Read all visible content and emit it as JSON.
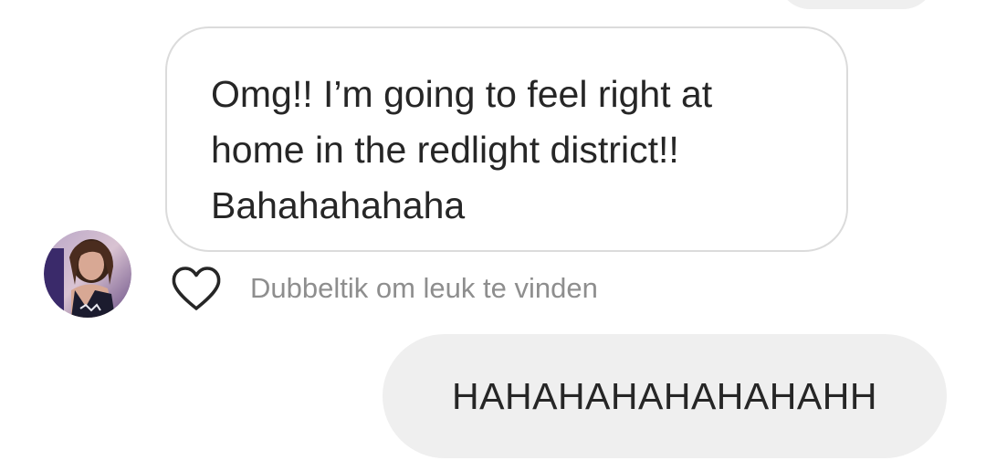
{
  "messages": {
    "incoming": {
      "text": "Omg!! I’m going to feel right at\nhome in the redlight district!!\nBahahahahaha",
      "like_hint": "Dubbeltik om leuk te vinden"
    },
    "outgoing": {
      "text": "HAHAHAHAHAHAHAHH"
    }
  },
  "icons": {
    "like": "heart-outline-icon",
    "avatar": "profile-photo"
  },
  "colors": {
    "incoming_border": "#dbdbdb",
    "outgoing_bg": "#efefef",
    "text": "#262626",
    "hint": "#8e8e8e"
  }
}
